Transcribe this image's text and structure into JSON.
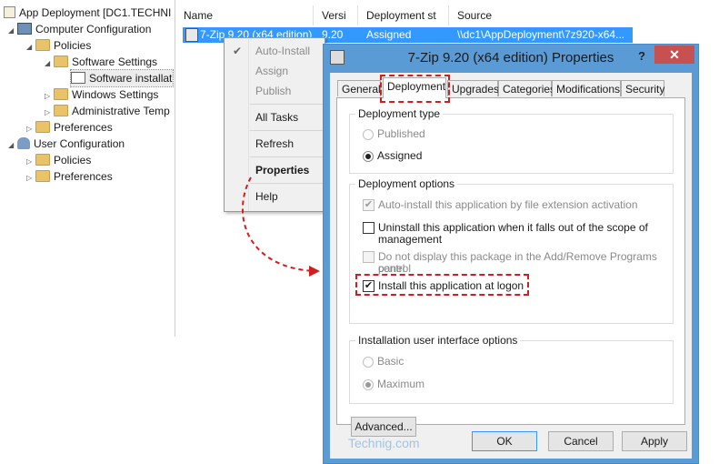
{
  "tree": {
    "root": "App Deployment  [DC1.TECHNI",
    "computer_config": "Computer Configuration",
    "policies": "Policies",
    "software_settings": "Software Settings",
    "software_installation": "Software installat",
    "windows_settings": "Windows Settings",
    "admin_templates": "Administrative Temp",
    "preferences": "Preferences",
    "user_config": "User Configuration",
    "user_policies": "Policies",
    "user_preferences": "Preferences"
  },
  "list": {
    "columns": [
      "Name",
      "Versi",
      "Deployment st",
      "Source"
    ],
    "row": {
      "name": "7-Zip 9.20 (x64 edition)",
      "version": "9.20",
      "state": "Assigned",
      "source": "\\\\dc1\\AppDeployment\\7z920-x64..."
    }
  },
  "context_menu": {
    "auto_install": "Auto-Install",
    "assign": "Assign",
    "publish": "Publish",
    "all_tasks": "All Tasks",
    "refresh": "Refresh",
    "properties": "Properties",
    "help": "Help"
  },
  "dialog": {
    "title": "7-Zip 9.20 (x64 edition) Properties",
    "help": "?",
    "close": "✕",
    "tabs": [
      "General",
      "Deployment",
      "Upgrades",
      "Categories",
      "Modifications",
      "Security"
    ],
    "deployment_type": {
      "title": "Deployment type",
      "published": "Published",
      "assigned": "Assigned"
    },
    "deployment_options": {
      "title": "Deployment options",
      "auto_install": "Auto-install this application by file extension activation",
      "uninstall_line1": "Uninstall this application when it falls out of the scope of",
      "uninstall_line2": "management",
      "no_display_line1": "Do not display this package in the Add/Remove Programs control",
      "no_display_line2": "panel",
      "install_at_logon": "Install this application at logon"
    },
    "ui_options": {
      "title": "Installation user interface options",
      "basic": "Basic",
      "maximum": "Maximum"
    },
    "advanced": "Advanced...",
    "ok": "OK",
    "cancel": "Cancel",
    "apply": "Apply",
    "watermark": "Technig.com"
  },
  "colors": {
    "selection": "#3399ff",
    "highlight": "#d21e1e",
    "dialog_frame": "#5b9bd5",
    "close_button": "#c75050"
  }
}
